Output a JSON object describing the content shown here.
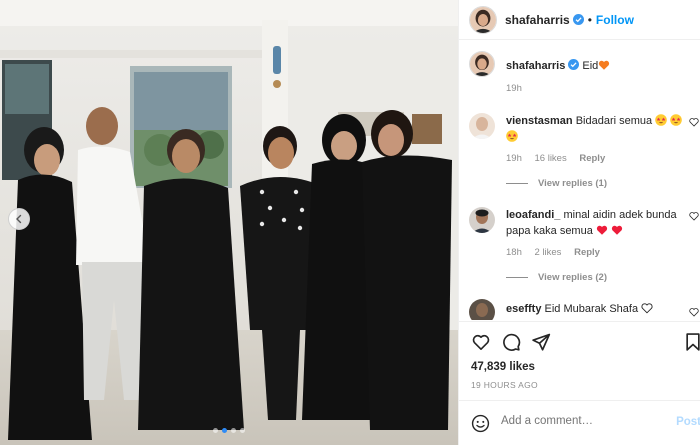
{
  "post": {
    "author": "shafaharris",
    "follow_label": "Follow",
    "caption_text": "Eid",
    "caption_age": "19h",
    "likes": "47,839 likes",
    "posted_ago": "19 HOURS AGO",
    "carousel": {
      "count": 4,
      "active_index": 1
    }
  },
  "comments": [
    {
      "user": "vienstasman",
      "text": "Bidadari semua",
      "emoji": [
        "star-struck-emoji",
        "star-struck-emoji",
        "star-struck-emoji"
      ],
      "age": "19h",
      "likes": "16 likes",
      "reply": "Reply",
      "view_replies": "View replies (1)"
    },
    {
      "user": "leoafandi_",
      "text": "minal aidin adek bunda papa kaka semua",
      "emoji": [
        "red-heart-emoji",
        "red-heart-emoji"
      ],
      "age": "18h",
      "likes": "2 likes",
      "reply": "Reply",
      "view_replies": "View replies (2)"
    },
    {
      "user": "eseffty",
      "text": "Eid Mubarak Shafa",
      "emoji": [
        "white-heart-emoji"
      ]
    }
  ],
  "composer": {
    "placeholder": "Add a comment…",
    "post_label": "Post"
  },
  "icons": [
    "chevron-left-icon",
    "verified-badge-icon",
    "heart-icon",
    "comment-icon",
    "share-icon",
    "bookmark-icon",
    "smile-icon"
  ],
  "colors": {
    "accent": "#0095f6",
    "verified": "#3897f0",
    "muted": "#8e8e8e",
    "text": "#262626",
    "heart_red": "#ed1c3a",
    "carousel_active_dot": "#2f8bf5"
  }
}
